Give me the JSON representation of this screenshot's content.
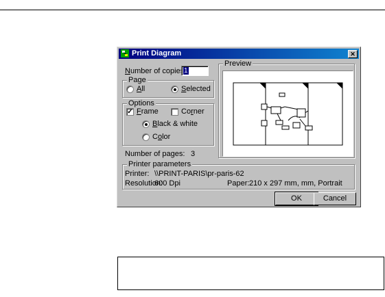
{
  "dialog": {
    "title": "Print Diagram",
    "close_glyph": "✕",
    "copies": {
      "label_pre": "",
      "label_u": "N",
      "label_post": "umber of copies:",
      "value": "1"
    },
    "page_group": {
      "label": "Page",
      "all": {
        "u": "A",
        "rest": "ll",
        "selected": false
      },
      "selected": {
        "u": "S",
        "rest": "elected",
        "selected": true
      }
    },
    "options_group": {
      "label": "Options",
      "frame": {
        "u": "F",
        "rest": "rame",
        "checked": true
      },
      "corner": {
        "pre": "Co",
        "u": "r",
        "rest": "ner",
        "checked": false
      },
      "bw": {
        "u": "B",
        "rest": "lack & white",
        "selected": true
      },
      "color": {
        "pre": "C",
        "u": "o",
        "rest": "lor",
        "selected": false
      }
    },
    "pages": {
      "label": "Number of pages:",
      "value": "3"
    },
    "preview": {
      "label": "Preview"
    },
    "printer_group": {
      "label": "Printer parameters",
      "printer_label": "Printer:",
      "printer_value": "\\\\PRINT-PARIS\\pr-paris-62",
      "resolution_label": "Resolution:",
      "resolution_value": "600 Dpi",
      "paper_label": "Paper:",
      "paper_value": "210 x 297 mm, mm, Portrait"
    },
    "ok_label": "OK",
    "cancel_label": "Cancel"
  },
  "icons": {
    "app": "print-diagram-app-icon",
    "close": "close-icon"
  }
}
